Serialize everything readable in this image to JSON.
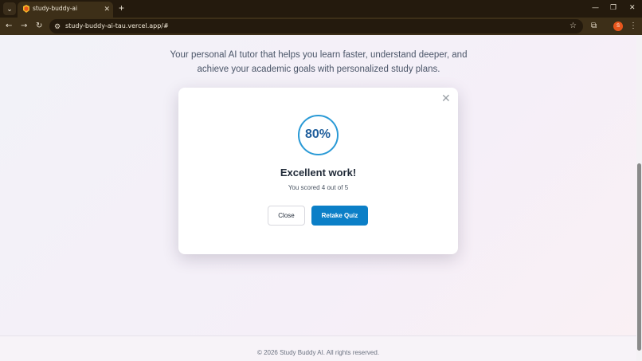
{
  "browser": {
    "tab_title": "study-buddy-ai",
    "tab_close": "✕",
    "new_tab": "+",
    "url": "study-buddy-ai-tau.vercel.app/#",
    "profile_initial": "S",
    "minimize": "—",
    "restore": "❐",
    "close_window": "✕"
  },
  "page": {
    "hero_line1": "Your personal AI tutor that helps you learn faster, understand deeper, and",
    "hero_line2": "achieve your academic goals with personalized study plans.",
    "footer": "© 2026 Study Buddy AI. All rights reserved."
  },
  "modal": {
    "close_icon": "✕",
    "score_percent": "80%",
    "title": "Excellent work!",
    "subtitle": "You scored 4 out of 5",
    "close_button": "Close",
    "retake_button": "Retake Quiz"
  },
  "colors": {
    "accent": "#0b7fc7",
    "ring": "#2a9ad6",
    "score_text": "#1f5e9c",
    "chrome_dark": "#241a0d",
    "chrome_toolbar": "#3d2f18"
  },
  "icons": {
    "tab_list": "chevron-down-icon",
    "back": "arrow-left-icon",
    "forward": "arrow-right-icon",
    "reload": "reload-icon",
    "site_info": "tune-icon",
    "bookmark": "star-icon",
    "extensions": "puzzle-icon",
    "menu": "kebab-menu-icon"
  }
}
